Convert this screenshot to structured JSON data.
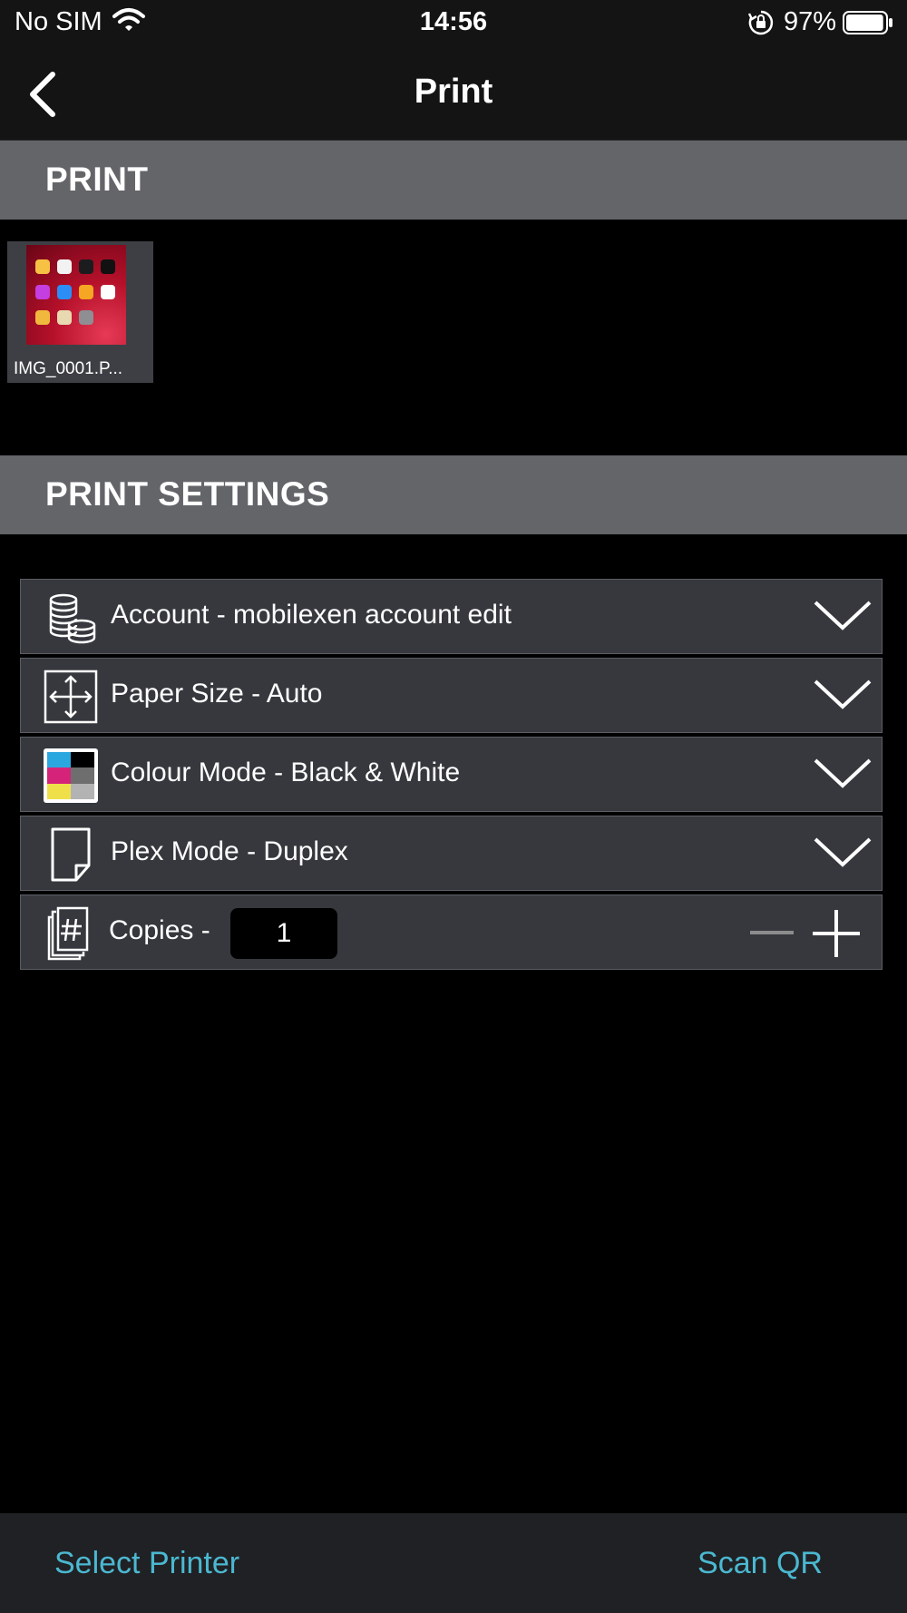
{
  "status_bar": {
    "carrier": "No SIM",
    "time": "14:56",
    "battery": "97%",
    "battery_level": 0.97
  },
  "nav": {
    "title": "Print",
    "back_icon": "chevron-left-icon"
  },
  "print_section": {
    "header": "PRINT",
    "files": [
      {
        "name": "IMG_0001.P..."
      }
    ]
  },
  "settings_section": {
    "header": "PRINT SETTINGS",
    "items": [
      {
        "label": "Account - mobilexen account edit",
        "icon": "coins-icon"
      },
      {
        "label": "Paper Size - Auto",
        "icon": "resize-arrows-icon"
      },
      {
        "label": "Colour Mode - Black & White",
        "icon": "colour-palette-icon"
      },
      {
        "label": "Plex Mode - Duplex",
        "icon": "page-icon"
      }
    ],
    "copies": {
      "label": "Copies -",
      "value": "1"
    }
  },
  "bottom_bar": {
    "select_printer": "Select Printer",
    "scan_qr": "Scan QR"
  },
  "colors": {
    "accent": "#4bb8d1",
    "section_header": "#636569",
    "row_background": "#36383e"
  }
}
